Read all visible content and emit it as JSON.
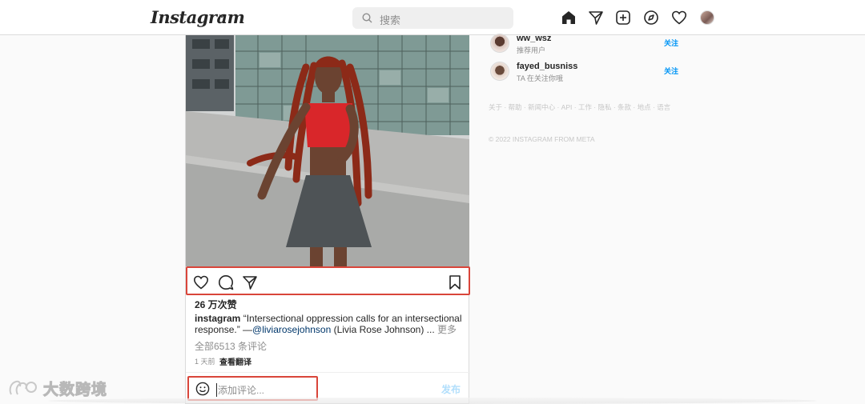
{
  "nav": {
    "logo": "Instagram",
    "search_placeholder": "搜索",
    "icons": [
      "home-icon",
      "direct-icon",
      "new-post-icon",
      "explore-icon",
      "activity-icon",
      "profile-avatar"
    ]
  },
  "post": {
    "likes": "26 万次赞",
    "caption_user": "instagram",
    "caption_text": " “Intersectional oppression calls for an intersectional response.” —",
    "caption_mention": "@liviarosejohnson",
    "caption_rest": " (Livia Rose Johnson) ... ",
    "caption_more": "更多",
    "comments_link": "全部6513 条评论",
    "time": "1 天前",
    "translate": "查看翻译",
    "comment_placeholder": "添加评论...",
    "post_button": "发布"
  },
  "suggestions": [
    {
      "username": "ww_wsz",
      "subtitle": "推荐用户",
      "follow": "关注"
    },
    {
      "username": "fayed_busniss",
      "subtitle": "TA 在关注你哦",
      "follow": "关注"
    }
  ],
  "footer": {
    "links": "关于 · 帮助 · 新闻中心 · API · 工作 · 隐私 · 条款 · 地点 · 语言",
    "copyright": "© 2022 INSTAGRAM FROM META"
  },
  "watermark": "大数跨境",
  "colors": {
    "accent": "#0095f6",
    "highlight": "#d9453a"
  }
}
